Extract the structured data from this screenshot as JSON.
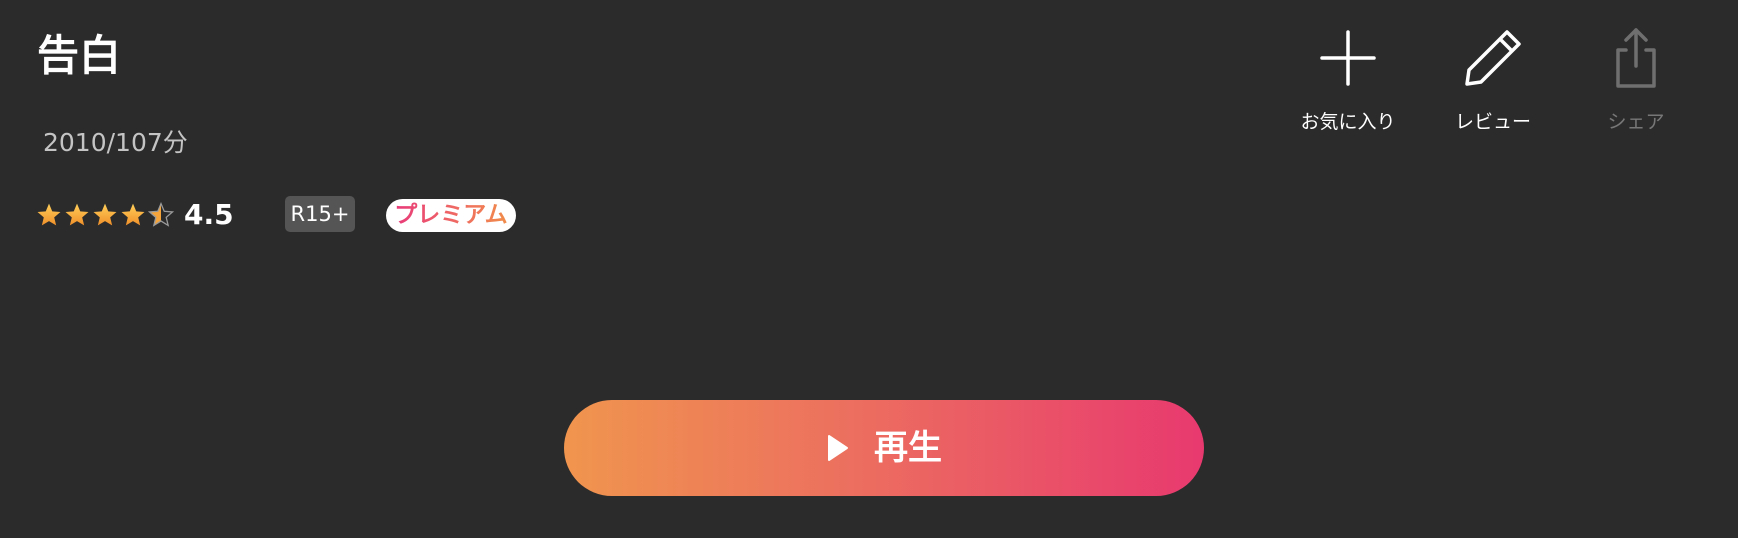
{
  "movie": {
    "title": "告白",
    "meta": "2010/107分",
    "rating": {
      "value": 4.5,
      "display": "4.5",
      "max": 5
    },
    "age_rating": "R15+",
    "premium_label": "プレミアム"
  },
  "actions": {
    "favorite": {
      "label": "お気に入り",
      "icon": "plus-icon"
    },
    "review": {
      "label": "レビュー",
      "icon": "pencil-icon"
    },
    "share": {
      "label": "シェア",
      "icon": "share-icon",
      "enabled": false
    }
  },
  "play": {
    "label": "再生",
    "icon": "play-icon"
  },
  "colors": {
    "background": "#2b2b2b",
    "star": "#f4a43a",
    "play_gradient_start": "#f0954e",
    "play_gradient_end": "#e8396f",
    "badge_gray": "#555555",
    "disabled_text": "#777777"
  }
}
